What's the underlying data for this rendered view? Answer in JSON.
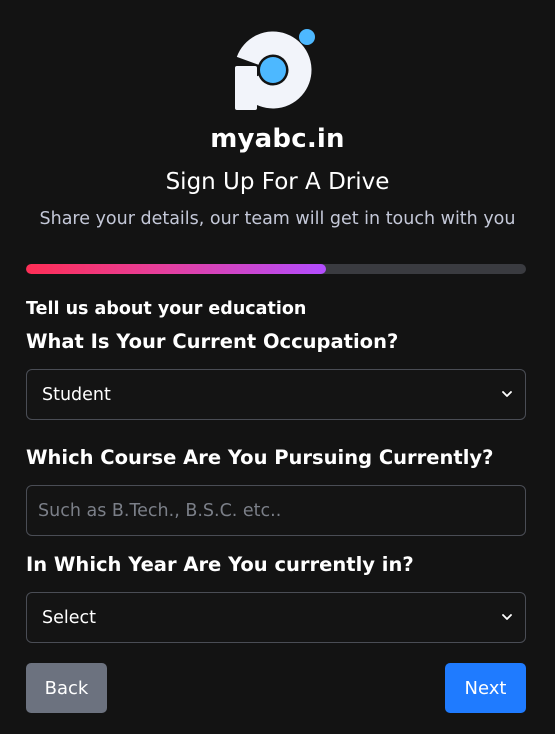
{
  "brand": {
    "name": "myabc.in",
    "logo_icon": "brand-logo-icon",
    "colors": {
      "logo_ring": "#f2f4fa",
      "logo_dot": "#4db8ff"
    }
  },
  "header": {
    "title": "Sign Up For A Drive",
    "subtitle": "Share your details, our team will get in touch with you"
  },
  "progress": {
    "fraction": 0.6,
    "colors": [
      "#ff2e55",
      "#b24dff"
    ],
    "track_color": "#3a3b40"
  },
  "form": {
    "section_label": "Tell us about your education",
    "occupation": {
      "question": "What Is Your Current Occupation?",
      "selected": "Student"
    },
    "course": {
      "question": "Which Course Are You Pursuing Currently?",
      "placeholder": "Such as B.Tech., B.S.C. etc..",
      "value": ""
    },
    "year": {
      "question": "In Which Year Are You currently in?",
      "selected": "Select"
    }
  },
  "actions": {
    "back_label": "Back",
    "next_label": "Next",
    "back_color": "#6c727f",
    "next_color": "#1f7bff"
  }
}
